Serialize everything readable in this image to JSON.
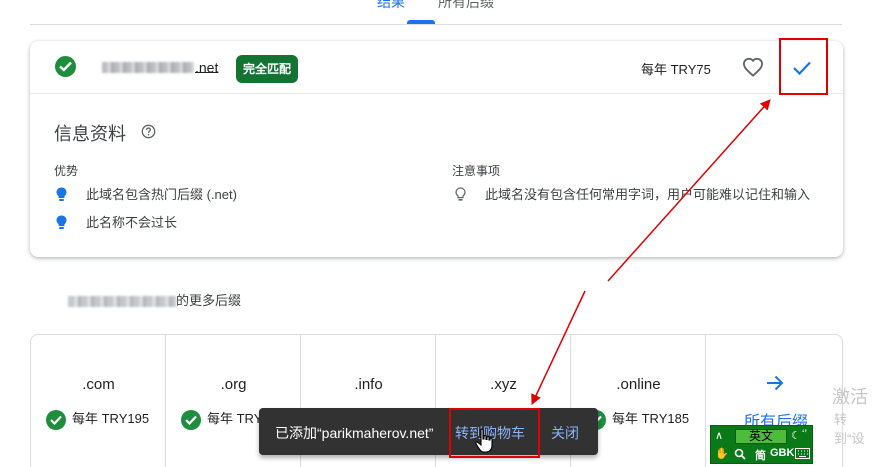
{
  "tabs": [
    {
      "label": "结果",
      "active": true
    },
    {
      "label": "所有后缀",
      "active": false
    }
  ],
  "result": {
    "domain_ext": ".net",
    "match_badge": "完全匹配",
    "price": "每年 TRY75"
  },
  "info": {
    "title": "信息资料",
    "advantages_title": "优势",
    "advantages": [
      "此域名包含热门后缀 (.net)",
      "此名称不会过长"
    ],
    "notes_title": "注意事项",
    "notes": [
      "此域名没有包含任何常用字词，用户可能难以记住和输入"
    ]
  },
  "more": {
    "suffix_label": "的更多后缀",
    "extensions": [
      {
        "name": ".com",
        "price": "每年 TRY195"
      },
      {
        "name": ".org",
        "price": "每年 TRY"
      },
      {
        "name": ".info",
        "price": ""
      },
      {
        "name": ".xyz",
        "price": ""
      },
      {
        "name": ".online",
        "price": "每年 TRY185"
      }
    ],
    "all_suffix_label": "所有后缀"
  },
  "snackbar": {
    "message": "已添加“parikmaherov.net”",
    "go_to_cart": "转到购物车",
    "close": "关闭"
  },
  "watermark": {
    "line1": "激活",
    "line2": "转到“设"
  },
  "ime": {
    "mode": "英文",
    "chars": "简",
    "encoding": "GBK"
  },
  "colors": {
    "accent": "#1a73e8",
    "success": "#1e8e3e",
    "badge": "#137333",
    "annotation": "#e00000"
  }
}
